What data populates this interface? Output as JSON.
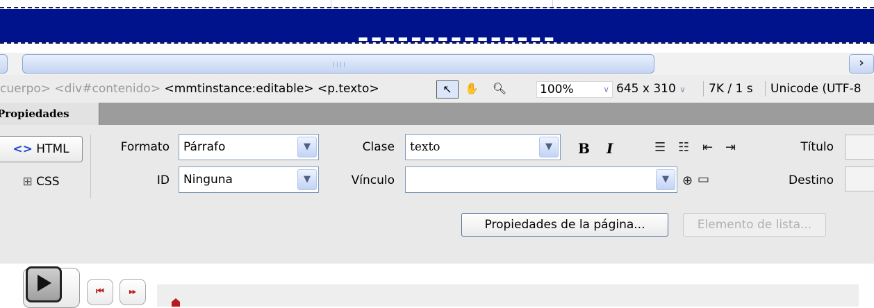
{
  "breadcrumb": {
    "tags_dim": [
      "cuerpo>",
      "<div#contenido>"
    ],
    "tags": [
      "<mmtinstance:editable>",
      "<p.texto>"
    ]
  },
  "statusbar": {
    "zoom": "100%",
    "dimensions": "645 x 310",
    "download": "7K / 1 s",
    "encoding": "Unicode (UTF-8"
  },
  "panel": {
    "title": "Propiedades",
    "html_button": "HTML",
    "css_button": "CSS",
    "formato_label": "Formato",
    "formato_value": "Párrafo",
    "id_label": "ID",
    "id_value": "Ninguna",
    "clase_label": "Clase",
    "clase_value": "texto",
    "vinculo_label": "Vínculo",
    "vinculo_value": "",
    "titulo_label": "Título",
    "destino_label": "Destino",
    "bold": "B",
    "italic": "I",
    "page_props_button": "Propiedades de la página...",
    "list_item_button": "Elemento de lista..."
  },
  "colors": {
    "header_band": "#00138d",
    "panel_bg": "#e9e9e9"
  },
  "icons": [
    "pointer-tool-icon",
    "hand-tool-icon",
    "zoom-tool-icon",
    "unordered-list-icon",
    "ordered-list-icon",
    "outdent-icon",
    "indent-icon",
    "point-to-file-icon",
    "browse-folder-icon",
    "play-icon",
    "rewind-icon",
    "fast-forward-icon"
  ]
}
